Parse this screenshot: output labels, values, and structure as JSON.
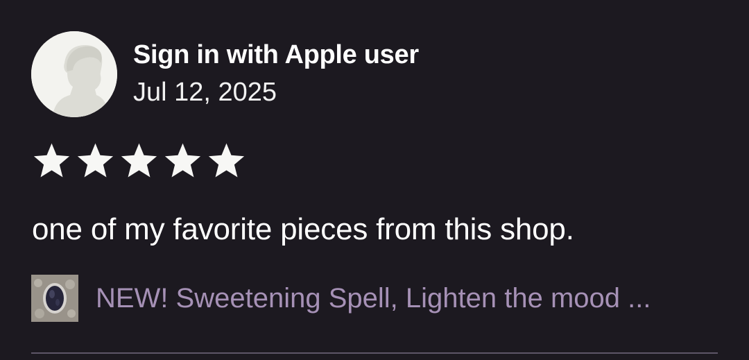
{
  "review": {
    "user_name": "Sign in with Apple user",
    "date": "Jul 12, 2025",
    "rating": 5,
    "rating_max": 5,
    "text": "one of my favorite pieces from this shop.",
    "item_title": "NEW! Sweetening Spell, Lighten the mood ..."
  },
  "icons": {
    "avatar": "person-silhouette-icon",
    "star": "star-filled-icon"
  },
  "colors": {
    "background": "#1c1920",
    "star": "#f7f7f5",
    "item_link": "#a691b6",
    "divider": "#5e5668"
  }
}
